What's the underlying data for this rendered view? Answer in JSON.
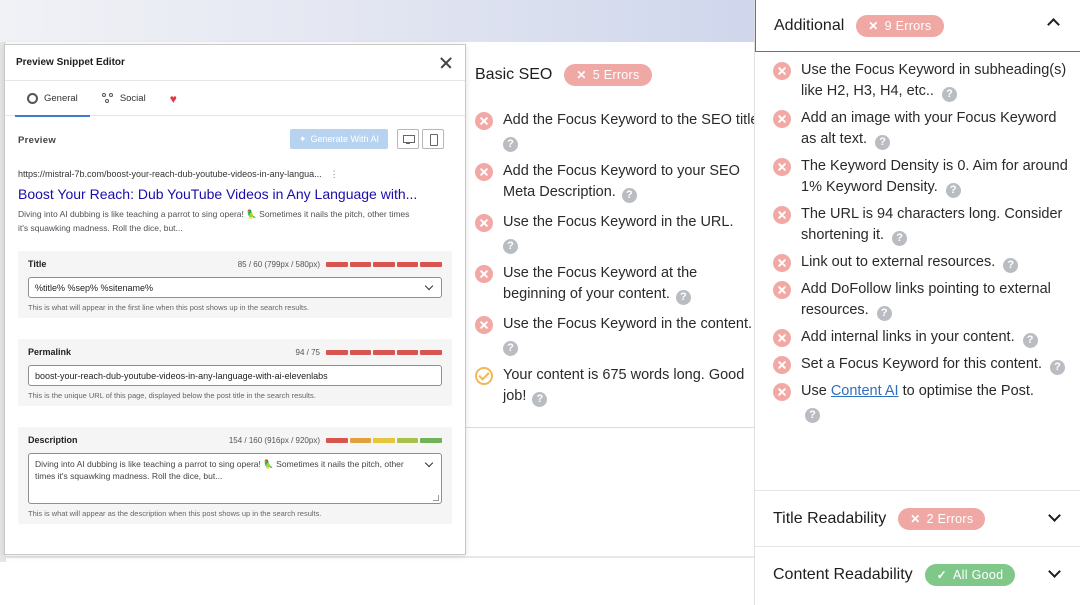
{
  "colors": {
    "error_badge": "#f0a8a5",
    "good_badge": "#7fc88a",
    "fail_icon": "#f2a9a6",
    "warn_icon": "#f2b659",
    "link": "#1a0dab",
    "accent": "#3d7cc9",
    "meter_red": "#d9534f",
    "meter_orange": "#e0a13a",
    "meter_yellow": "#e4c53c",
    "meter_lime": "#a9c14a",
    "meter_green": "#6fb25a"
  },
  "basic_seo": {
    "title": "Basic SEO",
    "badge": "5 Errors",
    "items": [
      {
        "status": "fail",
        "text": "Add the Focus Keyword to the SEO title",
        "text2": ""
      },
      {
        "status": "fail",
        "text": "Add the Focus Keyword to your SEO",
        "text2": "Meta Description."
      },
      {
        "status": "fail",
        "text": "Use the Focus Keyword in the URL.",
        "text2": ""
      },
      {
        "status": "fail",
        "text": "Use the Focus Keyword at the",
        "text2": "beginning of your content."
      },
      {
        "status": "fail",
        "text": "Use the Focus Keyword in the content.",
        "text2": ""
      },
      {
        "status": "ok",
        "text": "Your content is 675 words long. Good",
        "text2": "job!"
      }
    ]
  },
  "additional": {
    "title": "Additional",
    "badge": "9 Errors",
    "items": [
      {
        "text": "Use the Focus Keyword in subheading(s) like H2, H3, H4, etc.."
      },
      {
        "text": "Add an image with your Focus Keyword as alt text."
      },
      {
        "text": "The Keyword Density is 0. Aim for around 1% Keyword Density."
      },
      {
        "text": "The URL is 94 characters long. Consider shortening it."
      },
      {
        "text": "Link out to external resources."
      },
      {
        "text": "Add DoFollow links pointing to external resources."
      },
      {
        "text": "Add internal links in your content."
      },
      {
        "text": "Set a Focus Keyword for this content."
      }
    ],
    "last_item": {
      "prefix": "Use ",
      "link": "Content AI",
      "suffix": " to optimise the Post."
    }
  },
  "title_readability": {
    "title": "Title Readability",
    "badge": "2 Errors"
  },
  "content_readability": {
    "title": "Content Readability",
    "badge": "All Good"
  },
  "modal": {
    "title": "Preview Snippet Editor",
    "tabs": {
      "general": "General",
      "social": "Social"
    },
    "preview_label": "Preview",
    "generate_btn": "Generate With AI",
    "snippet": {
      "url": "https://mistral-7b.com/boost-your-reach-dub-youtube-videos-in-any-langua...",
      "title": "Boost Your Reach: Dub YouTube Videos in Any Language with...",
      "desc": "Diving into AI dubbing is like teaching a parrot to sing opera! 🦜 Sometimes it nails the pitch, other times it's squawking madness. Roll the dice, but..."
    },
    "title_field": {
      "label": "Title",
      "count": "85 / 60 (799px / 580px)",
      "value": "%title% %sep% %sitename%",
      "help": "This is what will appear in the first line when this post shows up in the search results.",
      "meter": [
        "meter_red",
        "meter_red",
        "meter_red",
        "meter_red",
        "meter_red"
      ]
    },
    "permalink_field": {
      "label": "Permalink",
      "count": "94 / 75",
      "value": "boost-your-reach-dub-youtube-videos-in-any-language-with-ai-elevenlabs",
      "help": "This is the unique URL of this page, displayed below the post title in the search results.",
      "meter": [
        "meter_red",
        "meter_red",
        "meter_red",
        "meter_red",
        "meter_red"
      ]
    },
    "description_field": {
      "label": "Description",
      "count": "154 / 160 (916px / 920px)",
      "value": "Diving into AI dubbing is like teaching a parrot to sing opera! 🦜 Sometimes it nails the pitch, other times it's squawking madness. Roll the dice, but...",
      "help": "This is what will appear as the description when this post shows up in the search results.",
      "meter": [
        "meter_red",
        "meter_orange",
        "meter_yellow",
        "meter_lime",
        "meter_green"
      ]
    }
  }
}
